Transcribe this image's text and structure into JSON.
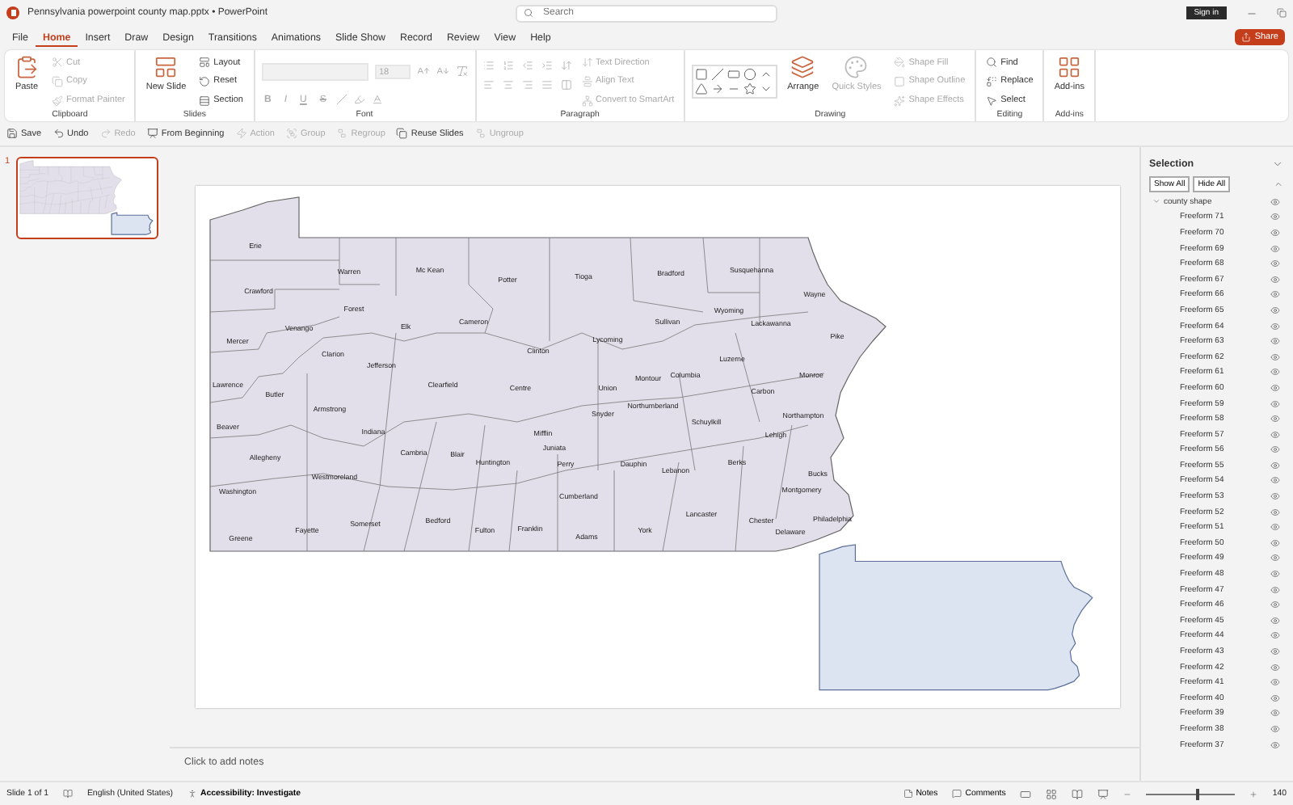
{
  "window": {
    "title": "Pennsylvania powerpoint county map.pptx  •  PowerPoint",
    "search_placeholder": "Search",
    "sign_in": "Sign in",
    "share": "Share"
  },
  "tabs": [
    {
      "label": "File",
      "selected": false
    },
    {
      "label": "Home",
      "selected": true
    },
    {
      "label": "Insert",
      "selected": false
    },
    {
      "label": "Draw",
      "selected": false
    },
    {
      "label": "Design",
      "selected": false
    },
    {
      "label": "Transitions",
      "selected": false
    },
    {
      "label": "Animations",
      "selected": false
    },
    {
      "label": "Slide Show",
      "selected": false
    },
    {
      "label": "Record",
      "selected": false
    },
    {
      "label": "Review",
      "selected": false
    },
    {
      "label": "View",
      "selected": false
    },
    {
      "label": "Help",
      "selected": false
    }
  ],
  "ribbon": {
    "groups": [
      {
        "kind": "plain",
        "label": "Clipboard",
        "items": [
          {
            "kind": "large",
            "label": "Paste",
            "disabled": false
          },
          {
            "kind": "small",
            "label": "Cut",
            "disabled": true
          },
          {
            "kind": "small",
            "label": "Copy",
            "disabled": true
          },
          {
            "kind": "small",
            "label": "Format Painter",
            "disabled": true
          }
        ]
      },
      {
        "kind": "plain",
        "label": "Slides",
        "items": [
          {
            "kind": "large",
            "label": "New Slide",
            "disabled": false
          },
          {
            "kind": "small",
            "label": "Layout",
            "disabled": false
          },
          {
            "kind": "small",
            "label": "Reset",
            "disabled": false
          },
          {
            "kind": "small",
            "label": "Section",
            "disabled": false
          }
        ]
      },
      {
        "kind": "font",
        "label": "Font",
        "items": [
          {
            "kind": "font-name",
            "disabled": true
          },
          {
            "kind": "font-size",
            "value": "18",
            "disabled": true
          },
          {
            "kind": "glyph",
            "label": "B",
            "disabled": true
          },
          {
            "kind": "glyph",
            "label": "I",
            "disabled": true
          },
          {
            "kind": "glyph",
            "label": "U",
            "disabled": true
          },
          {
            "kind": "glyph",
            "label": "S",
            "disabled": true
          }
        ]
      },
      {
        "kind": "paragraph",
        "label": "Paragraph",
        "items": [
          {
            "kind": "small",
            "label": "Text Direction",
            "disabled": true
          },
          {
            "kind": "small",
            "label": "Align Text",
            "disabled": true
          },
          {
            "kind": "small",
            "label": "Convert to SmartArt",
            "disabled": true
          }
        ]
      },
      {
        "kind": "drawing",
        "label": "Drawing",
        "items": [
          {
            "kind": "large",
            "label": "Arrange",
            "disabled": false
          },
          {
            "kind": "large",
            "label": "Quick Styles",
            "disabled": true
          },
          {
            "kind": "small",
            "label": "Shape Fill",
            "disabled": true
          },
          {
            "kind": "small",
            "label": "Shape Outline",
            "disabled": true
          },
          {
            "kind": "small",
            "label": "Shape Effects",
            "disabled": true
          }
        ]
      },
      {
        "kind": "plain",
        "label": "Editing",
        "items": [
          {
            "kind": "small",
            "label": "Find",
            "disabled": false
          },
          {
            "kind": "small",
            "label": "Replace",
            "disabled": false
          },
          {
            "kind": "small",
            "label": "Select",
            "disabled": false
          }
        ]
      },
      {
        "kind": "plain",
        "label": "Add-ins",
        "items": [
          {
            "kind": "large",
            "label": "Add-ins",
            "disabled": false
          }
        ]
      }
    ]
  },
  "quick_access": [
    {
      "label": "Save",
      "disabled": false
    },
    {
      "label": "Undo",
      "disabled": false
    },
    {
      "label": "Redo",
      "disabled": true
    },
    {
      "label": "From Beginning",
      "disabled": false
    },
    {
      "label": "Action",
      "disabled": true
    },
    {
      "label": "Group",
      "disabled": true
    },
    {
      "label": "Regroup",
      "disabled": true
    },
    {
      "label": "Reuse Slides",
      "disabled": false
    },
    {
      "label": "Ungroup",
      "disabled": true
    }
  ],
  "slides": [
    {
      "number": "1",
      "selected": true
    }
  ],
  "slide": {
    "counties": [
      "Erie",
      "Warren",
      "Mc Kean",
      "Potter",
      "Tioga",
      "Bradford",
      "Susquehanna",
      "Wayne",
      "Crawford",
      "Forest",
      "Cameron",
      "Elk",
      "Venango",
      "Sullivan",
      "Wyoming",
      "Lackawanna",
      "Lycoming",
      "Clinton",
      "Pike",
      "Mercer",
      "Clarion",
      "Jefferson",
      "Luzerne",
      "Montour",
      "Columbia",
      "Monroe",
      "Lawrence",
      "Clearfield",
      "Centre",
      "Union",
      "Butler",
      "Carbon",
      "Armstrong",
      "Northumberland",
      "Snyder",
      "Northampton",
      "Schuylkill",
      "Beaver",
      "Indiana",
      "Mifflin",
      "Lehigh",
      "Juniata",
      "Allegheny",
      "Cambria",
      "Blair",
      "Huntington",
      "Perry",
      "Dauphin",
      "Berks",
      "Lebanon",
      "Bucks",
      "Westmoreland",
      "Montgomery",
      "Washington",
      "Cumberland",
      "Lancaster",
      "Chester",
      "Philadelphia",
      "Delaware",
      "Somerset",
      "Bedford",
      "Fulton",
      "Franklin",
      "Fayette",
      "Greene",
      "York",
      "Adams"
    ]
  },
  "notes_placeholder": "Click to add notes",
  "selection_pane": {
    "title": "Selection",
    "show_all": "Show All",
    "hide_all": "Hide All",
    "tree": [
      {
        "label": "county shape",
        "expanded": true,
        "visible": true,
        "children": [
          {
            "label": "Freeform 71",
            "visible": true
          },
          {
            "label": "Freeform 70",
            "visible": true
          },
          {
            "label": "Freeform 69",
            "visible": true
          },
          {
            "label": "Freeform 68",
            "visible": true
          },
          {
            "label": "Freeform 67",
            "visible": true
          },
          {
            "label": "Freeform 66",
            "visible": true
          },
          {
            "label": "Freeform 65",
            "visible": true
          },
          {
            "label": "Freeform 64",
            "visible": true
          },
          {
            "label": "Freeform 63",
            "visible": true
          },
          {
            "label": "Freeform 62",
            "visible": true
          },
          {
            "label": "Freeform 61",
            "visible": true
          },
          {
            "label": "Freeform 60",
            "visible": true
          },
          {
            "label": "Freeform 59",
            "visible": true
          },
          {
            "label": "Freeform 58",
            "visible": true
          },
          {
            "label": "Freeform 57",
            "visible": true
          },
          {
            "label": "Freeform 56",
            "visible": true
          },
          {
            "label": "Freeform 55",
            "visible": true
          },
          {
            "label": "Freeform 54",
            "visible": true
          },
          {
            "label": "Freeform 53",
            "visible": true
          },
          {
            "label": "Freeform 52",
            "visible": true
          },
          {
            "label": "Freeform 51",
            "visible": true
          },
          {
            "label": "Freeform 50",
            "visible": true
          },
          {
            "label": "Freeform 49",
            "visible": true
          },
          {
            "label": "Freeform 48",
            "visible": true
          },
          {
            "label": "Freeform 47",
            "visible": true
          },
          {
            "label": "Freeform 46",
            "visible": true
          },
          {
            "label": "Freeform 45",
            "visible": true
          },
          {
            "label": "Freeform 44",
            "visible": true
          },
          {
            "label": "Freeform 43",
            "visible": true
          },
          {
            "label": "Freeform 42",
            "visible": true
          },
          {
            "label": "Freeform 41",
            "visible": true
          },
          {
            "label": "Freeform 40",
            "visible": true
          },
          {
            "label": "Freeform 39",
            "visible": true
          },
          {
            "label": "Freeform 38",
            "visible": true
          },
          {
            "label": "Freeform 37",
            "visible": true
          }
        ]
      }
    ]
  },
  "status_bar": {
    "slide_info": "Slide 1 of 1",
    "language": "English (United States)",
    "accessibility": "Accessibility: Investigate",
    "notes": "Notes",
    "comments": "Comments",
    "zoom": "140",
    "zoom_slider": {
      "level": 0.55
    }
  }
}
